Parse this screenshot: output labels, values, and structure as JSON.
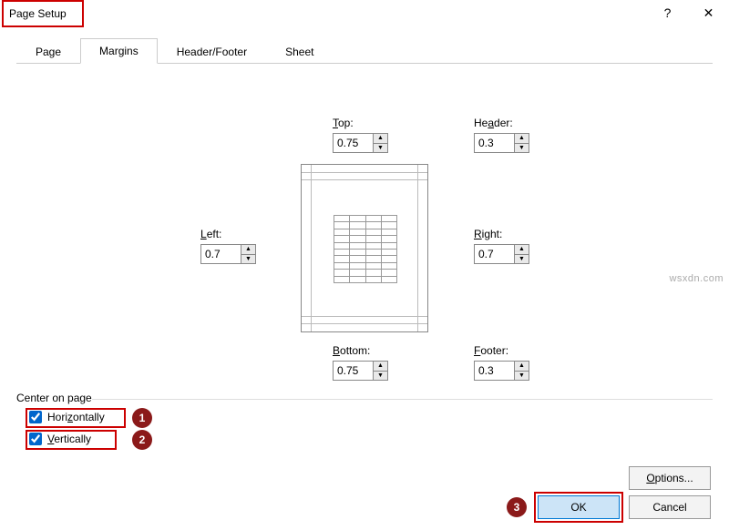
{
  "window": {
    "title": "Page Setup",
    "help": "?",
    "close": "✕"
  },
  "tabs": {
    "page": "Page",
    "margins": "Margins",
    "headerfooter": "Header/Footer",
    "sheet": "Sheet"
  },
  "margins": {
    "top_label": "Top:",
    "top_value": "0.75",
    "header_label": "Header:",
    "header_value": "0.3",
    "left_label": "Left:",
    "left_value": "0.7",
    "right_label": "Right:",
    "right_value": "0.7",
    "bottom_label": "Bottom:",
    "bottom_value": "0.75",
    "footer_label": "Footer:",
    "footer_value": "0.3"
  },
  "center": {
    "legend": "Center on page",
    "horizontally": "Horizontally",
    "vertically": "Vertically",
    "h_checked": true,
    "v_checked": true
  },
  "buttons": {
    "options": "Options...",
    "ok": "OK",
    "cancel": "Cancel"
  },
  "badges": {
    "b1": "1",
    "b2": "2",
    "b3": "3"
  },
  "watermark": "wsxdn.com"
}
